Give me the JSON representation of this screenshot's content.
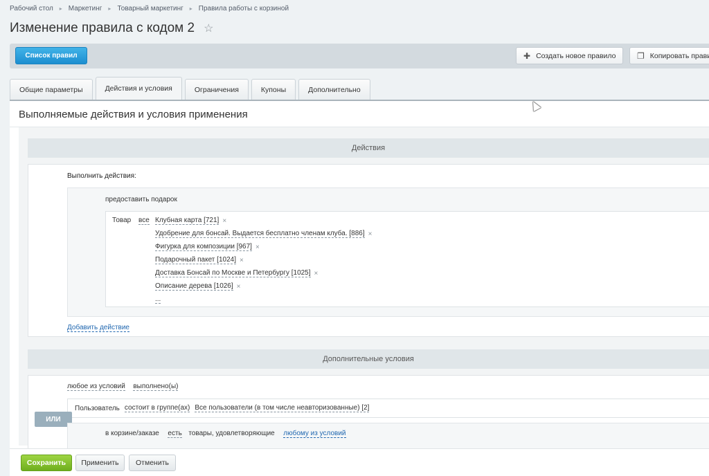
{
  "breadcrumb": [
    "Рабочий стол",
    "Маркетинг",
    "Товарный маркетинг",
    "Правила работы с корзиной"
  ],
  "page_title": "Изменение правила с кодом 2",
  "toolbar": {
    "list_button": "Список правил",
    "create_button": "Создать новое правило",
    "copy_button": "Копировать прави"
  },
  "tabs": [
    "Общие параметры",
    "Действия и условия",
    "Ограничения",
    "Купоны",
    "Дополнительно"
  ],
  "panel_title": "Выполняемые действия и условия применения",
  "actions": {
    "header": "Действия",
    "execute_label": "Выполнить действия:",
    "gift_label": "предоставить подарок",
    "product_label": "Товар",
    "all_label": "все",
    "items": [
      "Клубная карта [721]",
      "Удобрение для бонсай. Выдается бесплатно членам клуба. [886]",
      "Фигурка для композиции [967]",
      "Подарочный пакет [1024]",
      "Доставка Бонсай по Москве и Петербургу [1025]",
      "Описание дерева [1026]"
    ],
    "more": "...",
    "add_action": "Добавить действие"
  },
  "conditions": {
    "header": "Дополнительные условия",
    "any_of": "любое из условий",
    "fulfilled": "выполнено(ы)",
    "or_badge": "ИЛИ",
    "user_label": "Пользователь",
    "member_of": "состоит в группе(ах)",
    "all_users": "Все пользователи (в том числе неавторизованные) [2]",
    "basket_label": "в корзине/заказе",
    "exists": "есть",
    "goods_matching": "товары, удовлетворяющие",
    "any_condition": "любому из условий"
  },
  "footer": {
    "save": "Сохранить",
    "apply": "Применить",
    "cancel": "Отменить"
  },
  "icons": {
    "star": "star-icon",
    "plus": "plus-icon",
    "copy": "copy-icon",
    "remove": "remove-icon"
  },
  "colors": {
    "primary_blue": "#1c8ed0",
    "save_green": "#6fae1e",
    "link_blue": "#2067b0",
    "or_badge": "#9aafbc"
  }
}
